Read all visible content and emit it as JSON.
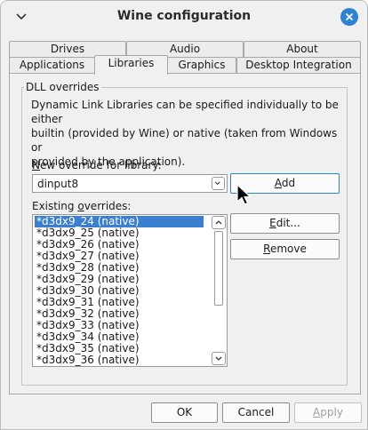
{
  "window": {
    "title": "Wine configuration"
  },
  "tabs_row1": [
    "Drives",
    "Audio",
    "About"
  ],
  "tabs_row2": [
    "Applications",
    "Libraries",
    "Graphics",
    "Desktop Integration"
  ],
  "active_tab": "Libraries",
  "group": {
    "title": "DLL overrides",
    "description_lines": [
      "Dynamic Link Libraries can be specified individually to be either",
      "builtin (provided by Wine) or native (taken from Windows or",
      "provided by the application)."
    ]
  },
  "new_override": {
    "label_mnemonic": "N",
    "label_rest": "ew override for library:",
    "value": "dinput8"
  },
  "existing": {
    "label_pre": "Existing ",
    "label_mnemonic": "o",
    "label_post": "verrides:",
    "items": [
      "*d3dx9_24 (native)",
      "*d3dx9_25 (native)",
      "*d3dx9_26 (native)",
      "*d3dx9_27 (native)",
      "*d3dx9_28 (native)",
      "*d3dx9_29 (native)",
      "*d3dx9_30 (native)",
      "*d3dx9_31 (native)",
      "*d3dx9_32 (native)",
      "*d3dx9_33 (native)",
      "*d3dx9_34 (native)",
      "*d3dx9_35 (native)",
      "*d3dx9_36 (native)"
    ],
    "selected_index": 0
  },
  "buttons": {
    "add_mnemonic": "A",
    "add_rest": "dd",
    "edit_mnemonic": "E",
    "edit_rest": "dit...",
    "remove_mnemonic": "R",
    "remove_rest": "emove",
    "ok": "OK",
    "cancel": "Cancel",
    "apply_mnemonic": "A",
    "apply_rest": "pply"
  },
  "colors": {
    "accent": "#2d82d2",
    "selection": "#3b7fd1"
  },
  "icons": {
    "window_menu": "chevron-down-icon",
    "close": "close-icon",
    "scroll_up": "chevron-up-icon",
    "scroll_down": "chevron-down-icon",
    "combo": "chevron-down-icon",
    "cursor": "mouse-pointer-icon"
  }
}
